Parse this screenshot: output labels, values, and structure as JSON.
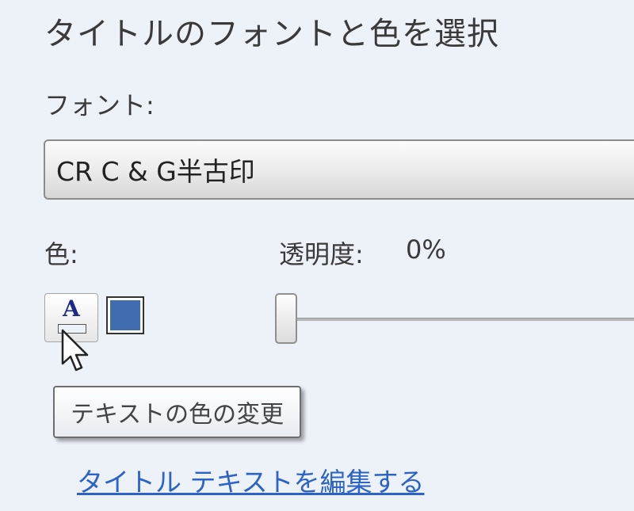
{
  "panel": {
    "heading": "タイトルのフォントと色を選択",
    "font_label": "フォント:",
    "font_value": "CR C & G半古印",
    "color_label": "色:",
    "opacity_label": "透明度:",
    "opacity_value": "0%",
    "opacity_level": 0,
    "text_color_button_glyph": "A",
    "swatch_color": "#3f6db0",
    "tooltip": "テキストの色の変更",
    "edit_link": "タイトル テキストを編集する"
  },
  "colors": {
    "background": "#edf1f8",
    "link": "#2b63c6",
    "glyph": "#1b2a8a"
  },
  "icons": {
    "cursor": "mouse-pointer-icon",
    "text_color": "text-color-icon"
  }
}
